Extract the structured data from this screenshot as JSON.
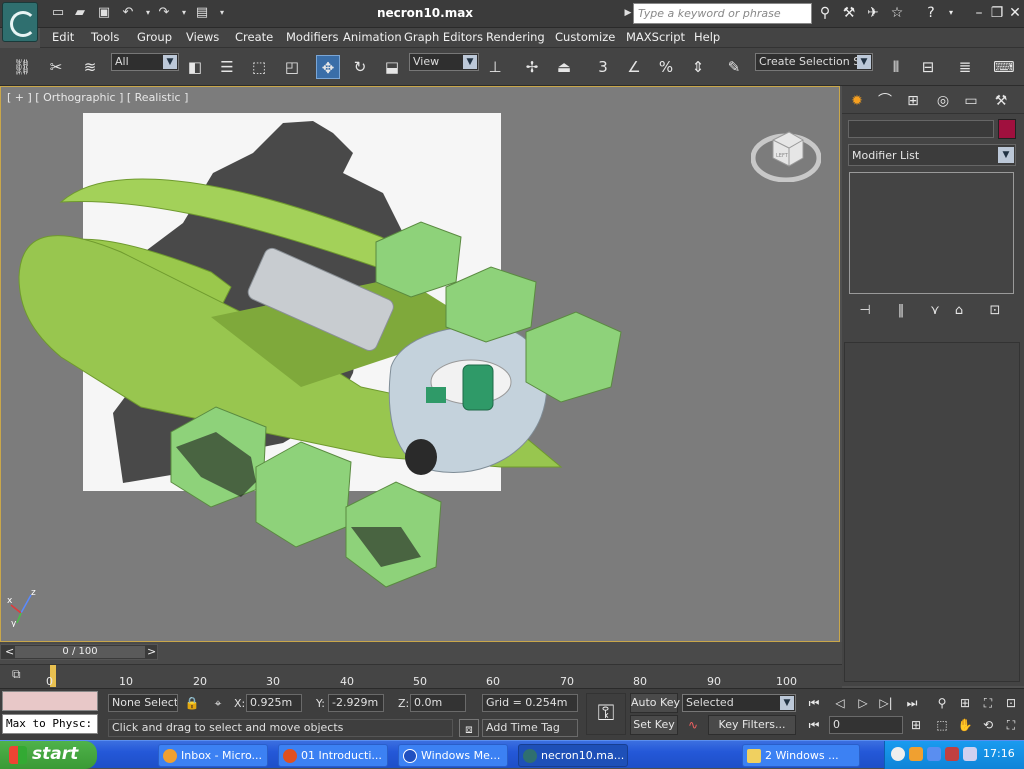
{
  "window": {
    "title": "necron10.max",
    "search_placeholder": "Type a keyword or phrase"
  },
  "menu": [
    "Edit",
    "Tools",
    "Group",
    "Views",
    "Create",
    "Modifiers",
    "Animation",
    "Graph Editors",
    "Rendering",
    "Customize",
    "MAXScript",
    "Help"
  ],
  "toolbar": {
    "filter_value": "All",
    "coord_value": "View",
    "snap_label": "3",
    "selection_set_placeholder": "Create Selection Se"
  },
  "viewport": {
    "label": "[ + ] [ Orthographic ] [ Realistic ]",
    "axis_x": "x",
    "axis_z": "z",
    "axis_y": "y",
    "viewcube_face": "LEFT"
  },
  "command_panel": {
    "modifier_list": "Modifier List",
    "object_color": "#a0103e"
  },
  "timeline": {
    "frame_counter": "0 / 100",
    "prev": "<",
    "next": ">",
    "ticks": [
      "0",
      "10",
      "20",
      "30",
      "40",
      "50",
      "60",
      "70",
      "80",
      "90",
      "100"
    ]
  },
  "status": {
    "listener_text": "Max to Physc:",
    "selection_text": "None Selected",
    "x_label": "X:",
    "x_value": "0.925m",
    "y_label": "Y:",
    "y_value": "-2.929m",
    "z_label": "Z:",
    "z_value": "0.0m",
    "grid": "Grid = 0.254m",
    "prompt": "Click and drag to select and move objects",
    "add_time_tag": "Add Time Tag",
    "auto_key": "Auto Key",
    "set_key": "Set Key",
    "key_mode_value": "Selected",
    "key_filters": "Key Filters...",
    "current_frame": "0"
  },
  "taskbar": {
    "start": "start",
    "tasks": [
      "Inbox - Micro...",
      "01 Introducti...",
      "Windows Me...",
      "necron10.ma...",
      "2 Windows ..."
    ],
    "clock": "17:16"
  }
}
